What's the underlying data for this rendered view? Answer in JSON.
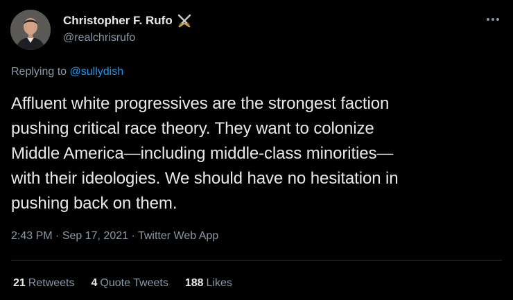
{
  "author": {
    "display_name": "Christopher F. Rufo",
    "handle": "@realchrisrufo",
    "badge_icon": "crossed-swords-icon",
    "avatar_icon": "profile-photo"
  },
  "menu_icon": "more-options-icon",
  "reply": {
    "prefix": "Replying to",
    "to_handle": "@sullydish"
  },
  "tweet_lines": [
    "Affluent white progressives are the strongest faction",
    "pushing critical race theory. They want to colonize",
    "Middle America—including middle-class minorities—",
    "with their ideologies. We should have no hesitation in",
    "pushing back on them."
  ],
  "meta": {
    "time": "2:43 PM",
    "date": "Sep 17, 2021",
    "separator": "·",
    "app": "Twitter Web App"
  },
  "stats": {
    "retweets_count": "21",
    "retweets_label": "Retweets",
    "quotes_count": "4",
    "quotes_label": "Quote Tweets",
    "likes_count": "188",
    "likes_label": "Likes"
  },
  "colors": {
    "background": "#000000",
    "text_primary": "#e7e9ea",
    "text_secondary": "#8b98a5",
    "link": "#1d9bf0",
    "divider": "#2f3336"
  }
}
